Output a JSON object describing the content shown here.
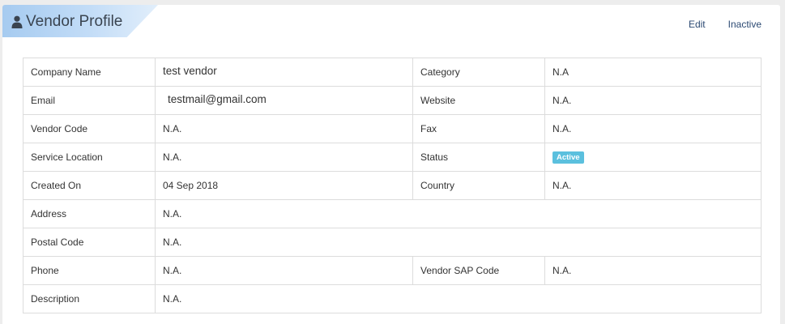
{
  "header": {
    "title": "Vendor Profile",
    "title_icon": "user-icon",
    "actions": {
      "edit": "Edit",
      "inactive": "Inactive"
    }
  },
  "fields": {
    "company_name": {
      "label": "Company Name",
      "value": "test vendor"
    },
    "category": {
      "label": "Category",
      "value": "N.A"
    },
    "email": {
      "label": "Email",
      "value": "testmail@gmail.com"
    },
    "website": {
      "label": "Website",
      "value": "N.A."
    },
    "vendor_code": {
      "label": "Vendor Code",
      "value": "N.A."
    },
    "fax": {
      "label": "Fax",
      "value": "N.A."
    },
    "service_location": {
      "label": "Service Location",
      "value": "N.A."
    },
    "status": {
      "label": "Status",
      "value": "Active"
    },
    "created_on": {
      "label": "Created On",
      "value": "04 Sep 2018"
    },
    "country": {
      "label": "Country",
      "value": "N.A."
    },
    "address": {
      "label": "Address",
      "value": "N.A."
    },
    "postal_code": {
      "label": "Postal Code",
      "value": "N.A."
    },
    "phone": {
      "label": "Phone",
      "value": "N.A."
    },
    "vendor_sap_code": {
      "label": "Vendor SAP Code",
      "value": "N.A."
    },
    "description": {
      "label": "Description",
      "value": "N.A."
    }
  },
  "colors": {
    "status_badge": "#5bc0de",
    "link": "#2c4a73",
    "title_tab_start": "#a6cbf0"
  }
}
